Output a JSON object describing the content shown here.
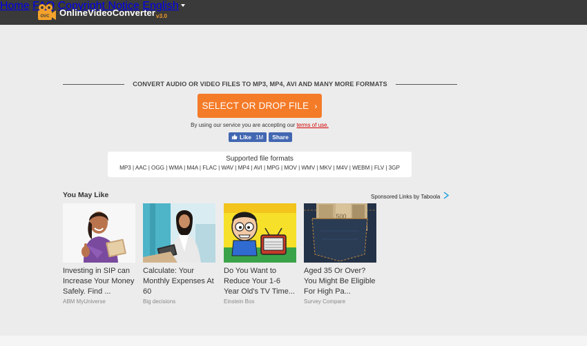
{
  "header": {
    "logo_part1": "Online",
    "logo_part2": "Video",
    "logo_part3": "Converter",
    "logo_version": "v3.0",
    "nav": {
      "home": "Home",
      "faq": "FAQ",
      "copyright": "Copyright Notice",
      "language": "English"
    }
  },
  "convert": {
    "heading": "CONVERT AUDIO OR VIDEO FILES TO MP3, MP4, AVI AND MANY MORE FORMATS",
    "button_label": "SELECT OR DROP FILE",
    "button_chevron": "›",
    "terms_prefix": "By using our service you are accepting our ",
    "terms_link": "terms of use."
  },
  "facebook": {
    "like_label": "Like",
    "like_count": "1M",
    "share_label": "Share"
  },
  "formats": {
    "title": "Supported file formats",
    "list": "MP3 | AAC | OGG | WMA | M4A | FLAC | WAV | MP4 | AVI | MPG | MOV | WMV | MKV | M4V | WEBM | FLV | 3GP"
  },
  "recommendations": {
    "heading": "You May Like",
    "sponsored": "Sponsored Links by Taboola",
    "cards": [
      {
        "title": "Investing in SIP can Increase Your Money Safely. Find ...",
        "source": "ABM MyUniverse"
      },
      {
        "title": "Calculate: Your Monthly Expenses At 60",
        "source": "Big decisions"
      },
      {
        "title": "Do You Want to Reduce Your 1-6 Year Old's TV Time...",
        "source": "Einstein Box"
      },
      {
        "title": "Aged 35 Or Over? You Might Be Eligible For High Pa...",
        "source": "Survey Compare"
      }
    ]
  },
  "colors": {
    "header_bg": "#3a3a3a",
    "accent_orange": "#f47b28",
    "facebook_blue": "#4267b2",
    "page_bg": "#ececec"
  }
}
